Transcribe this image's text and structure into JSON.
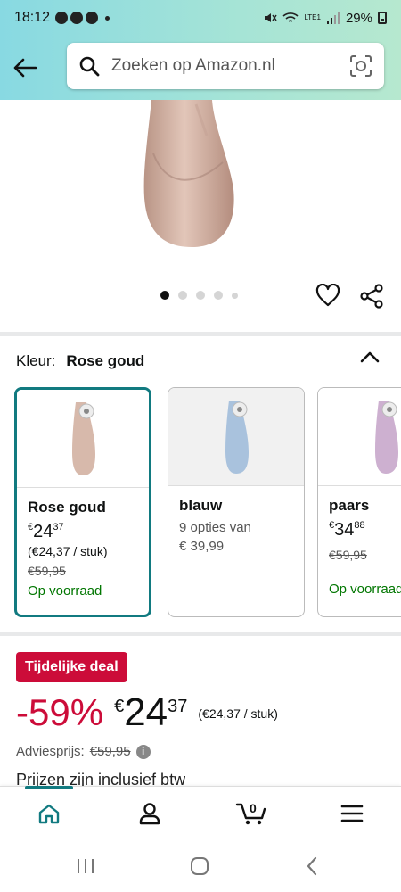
{
  "status": {
    "time": "18:12",
    "battery": "29%",
    "network": "LTE1"
  },
  "search": {
    "placeholder": "Zoeken op Amazon.nl"
  },
  "gallery": {
    "image_count": 5,
    "active_index": 0
  },
  "color_selector": {
    "label": "Kleur:",
    "value": "Rose goud"
  },
  "swatches": [
    {
      "name": "Rose goud",
      "price_currency": "€",
      "price_whole": "24",
      "price_frac": "37",
      "unit": "(€24,37 / stuk)",
      "was": "€59,95",
      "stock": "Op voorraad",
      "color": "#d7b9ab"
    },
    {
      "name": "blauw",
      "options": "9 opties van",
      "from_price": "€ 39,99",
      "color": "#a9c2dd"
    },
    {
      "name": "paars",
      "price_currency": "€",
      "price_whole": "34",
      "price_frac": "88",
      "was": "€59,95",
      "stock": "Op voorraad",
      "color": "#cdb0d0"
    }
  ],
  "deal": {
    "badge": "Tijdelijke deal",
    "discount": "-59%",
    "currency": "€",
    "price_whole": "24",
    "price_frac": "37",
    "unit_price": "(€24,37 / stuk)",
    "rrp_label": "Adviesprijs:",
    "rrp_value": "€59,95",
    "tax_note": "Prijzen zijn inclusief btw"
  },
  "cart": {
    "count": "0"
  },
  "colors": {
    "accent": "#117a80",
    "deal": "#cc0c39",
    "stock": "#007600"
  }
}
